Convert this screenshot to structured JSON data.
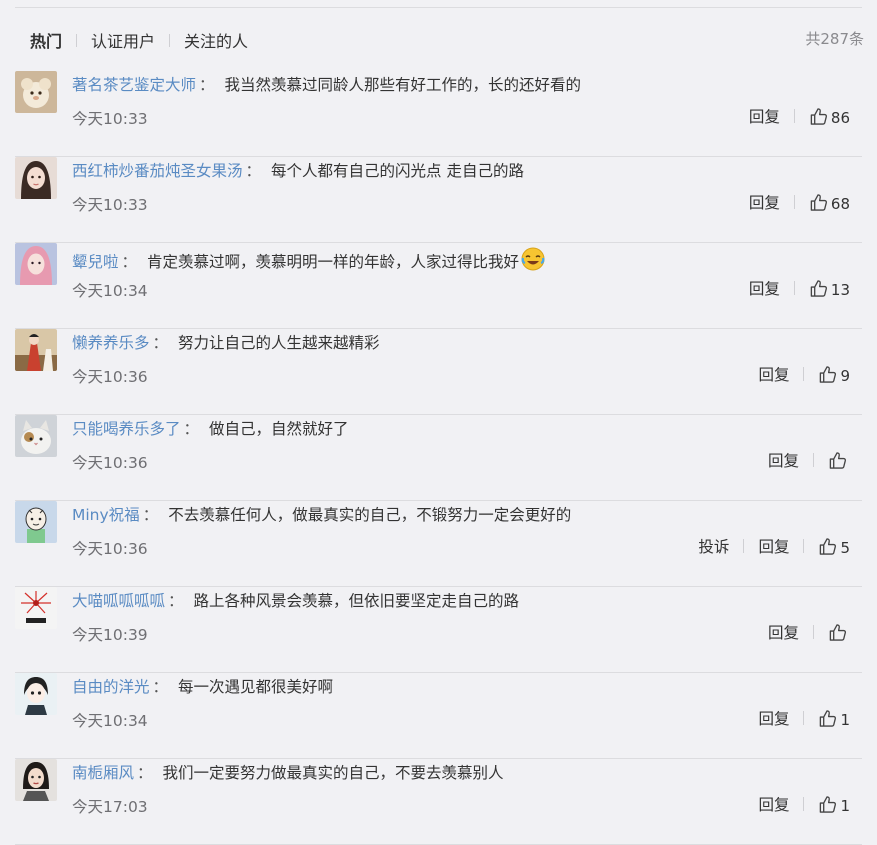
{
  "tabs": [
    {
      "label": "热门",
      "active": true
    },
    {
      "label": "认证用户",
      "active": false
    },
    {
      "label": "关注的人",
      "active": false
    }
  ],
  "total": "共287条",
  "reply_label": "回复",
  "report_label": "投诉",
  "comments": [
    {
      "name": "著名茶艺鉴定大师",
      "colon": "：",
      "text": "我当然羡慕过同龄人那些有好工作的，长的还好看的",
      "time": "今天10:33",
      "likes": "86"
    },
    {
      "name": "西红柿炒番茄炖圣女果汤",
      "colon": "：",
      "text": "每个人都有自己的闪光点 走自己的路",
      "time": "今天10:33",
      "likes": "68"
    },
    {
      "name": "颦兒啦",
      "colon": "：",
      "text": "肯定羡慕过啊，羡慕明明一样的年龄，人家过得比我好",
      "emoji": "laugh-cry-emoji",
      "time": "今天10:34",
      "likes": "13"
    },
    {
      "name": "懒养养乐多",
      "colon": "：",
      "text": "努力让自己的人生越来越精彩",
      "time": "今天10:36",
      "likes": "9"
    },
    {
      "name": "只能喝养乐多了",
      "colon": "：",
      "text": "做自己，自然就好了",
      "time": "今天10:36",
      "likes": ""
    },
    {
      "name": "Miny祝福",
      "colon": "：",
      "text": "不去羡慕任何人，做最真实的自己，不锻努力一定会更好的",
      "time": "今天10:36",
      "likes": "5",
      "has_report": true
    },
    {
      "name": "大喵呱呱呱呱",
      "colon": "：",
      "text": "路上各种风景会羡慕，但依旧要坚定走自己的路",
      "time": "今天10:39",
      "likes": ""
    },
    {
      "name": "自由的洋光",
      "colon": "：",
      "text": "每一次遇见都很美好啊",
      "time": "今天10:34",
      "likes": "1"
    },
    {
      "name": "南栀厢风",
      "colon": "：",
      "text": "我们一定要努力做最真实的自己，不要去羡慕别人",
      "time": "今天17:03",
      "likes": "1"
    }
  ],
  "colors": {
    "name_link": "#5a8bc3",
    "background": "#f1f1f4",
    "muted": "#6f6f73"
  }
}
